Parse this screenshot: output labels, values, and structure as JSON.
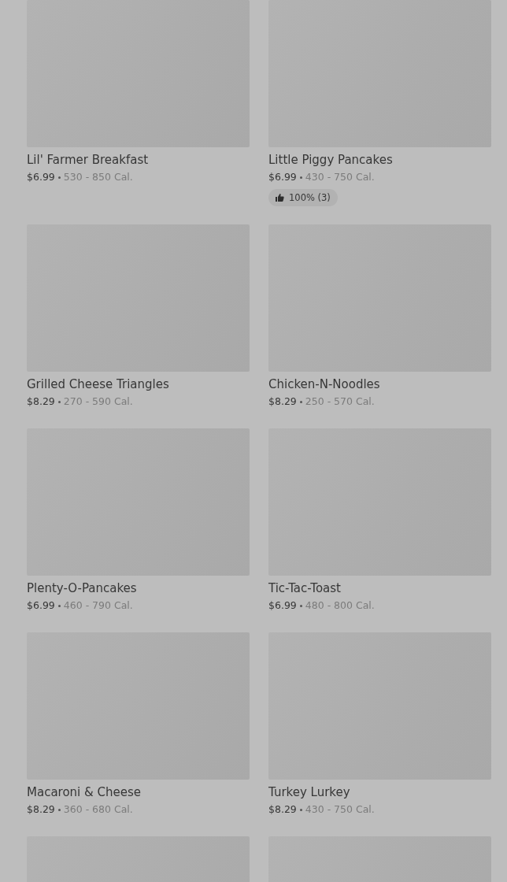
{
  "items": [
    {
      "kind": "dish",
      "name": "Lil' Farmer Breakfast",
      "price": "$6.99",
      "calories": "530 - 850 Cal."
    },
    {
      "kind": "dish",
      "name": "Little Piggy Pancakes",
      "price": "$6.99",
      "calories": "430 - 750 Cal.",
      "rating": "100% (3)"
    },
    {
      "kind": "dish",
      "name": "Grilled Cheese Triangles",
      "price": "$8.29",
      "calories": "270 - 590 Cal."
    },
    {
      "kind": "dish",
      "name": "Chicken-N-Noodles",
      "price": "$8.29",
      "calories": "250 - 570 Cal."
    },
    {
      "kind": "dish",
      "name": "Plenty-O-Pancakes",
      "price": "$6.99",
      "calories": "460 - 790 Cal."
    },
    {
      "kind": "dish",
      "name": "Tic-Tac-Toast",
      "price": "$6.99",
      "calories": "480 - 800 Cal."
    },
    {
      "kind": "dish",
      "name": "Macaroni & Cheese",
      "price": "$8.29",
      "calories": "360 - 680 Cal."
    },
    {
      "kind": "dish",
      "name": "Turkey Lurkey",
      "price": "$8.29",
      "calories": "430 - 750 Cal."
    },
    {
      "kind": "image-only"
    },
    {
      "kind": "image-only"
    }
  ]
}
